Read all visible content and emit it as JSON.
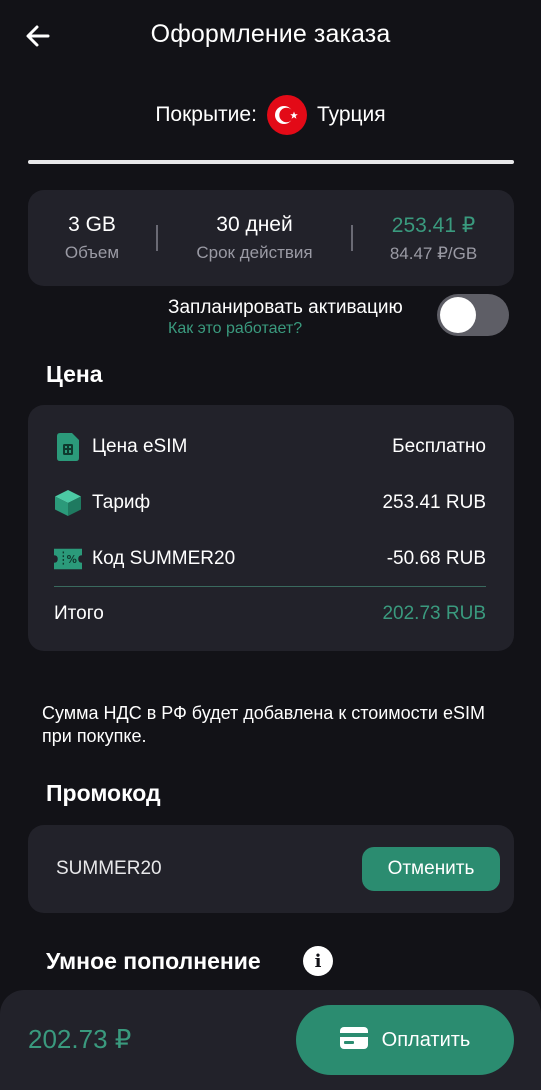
{
  "header": {
    "title": "Оформление заказа"
  },
  "coverage": {
    "label": "Покрытие:",
    "country": "Турция"
  },
  "plan": {
    "volume": "3 GB",
    "volume_label": "Объем",
    "validity": "30 дней",
    "validity_label": "Срок действия",
    "price": "253.41 ₽",
    "price_per_gb": "84.47 ₽/GB"
  },
  "schedule": {
    "label": "Запланировать активацию",
    "link": "Как это работает?",
    "enabled": false
  },
  "price_section": {
    "title": "Цена",
    "rows": [
      {
        "icon": "sim-card-icon",
        "label": "Цена eSIM",
        "value": "Бесплатно"
      },
      {
        "icon": "cube-icon",
        "label": "Тариф",
        "value": "253.41 RUB"
      },
      {
        "icon": "coupon-icon",
        "label": "Код SUMMER20",
        "value": "-50.68 RUB"
      }
    ],
    "total_label": "Итого",
    "total_value": "202.73 RUB"
  },
  "vat_note": "Сумма НДС в РФ будет добавлена к стоимости eSIM при покупке.",
  "promo": {
    "title": "Промокод",
    "code": "SUMMER20",
    "cancel_label": "Отменить"
  },
  "smart_topup": {
    "title": "Умное пополнение"
  },
  "footer": {
    "amount": "202.73 ₽",
    "pay_label": "Оплатить"
  },
  "colors": {
    "background": "#121217",
    "card": "#22222a",
    "accent": "#2b8c70",
    "accent_text": "#3a9a7e"
  }
}
